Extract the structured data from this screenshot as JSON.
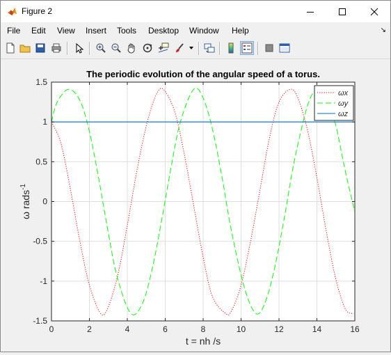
{
  "window": {
    "title": "Figure 2"
  },
  "menu": {
    "items": [
      "File",
      "Edit",
      "View",
      "Insert",
      "Tools",
      "Desktop",
      "Window",
      "Help"
    ]
  },
  "toolbar": {
    "buttons": [
      {
        "name": "new-figure-icon"
      },
      {
        "name": "open-file-icon"
      },
      {
        "name": "save-icon"
      },
      {
        "name": "print-icon"
      },
      {
        "name": "edit-plot-arrow-icon"
      },
      {
        "name": "zoom-in-icon"
      },
      {
        "name": "zoom-out-icon"
      },
      {
        "name": "pan-hand-icon"
      },
      {
        "name": "rotate-3d-icon"
      },
      {
        "name": "data-cursor-icon"
      },
      {
        "name": "brush-icon"
      },
      {
        "name": "link-plot-icon"
      },
      {
        "name": "colorbar-icon"
      },
      {
        "name": "legend-icon"
      },
      {
        "name": "hide-plot-tools-icon"
      },
      {
        "name": "show-plot-tools-icon"
      }
    ]
  },
  "chart_data": {
    "type": "line",
    "title": "The periodic evolution of the angular speed of a torus.",
    "xlabel": "t = nh /s",
    "ylabel": "ω rads",
    "ylabel_exponent": "-1",
    "xlim": [
      0,
      16
    ],
    "ylim": [
      -1.5,
      1.5
    ],
    "xticks": [
      "0",
      "2",
      "4",
      "6",
      "8",
      "10",
      "12",
      "14",
      "16"
    ],
    "yticks": [
      "1.5",
      "1",
      "0.5",
      "0",
      "-0.5",
      "-1",
      "-1.5"
    ],
    "grid": true,
    "legend_position": "top-right",
    "series": [
      {
        "name": "ωx",
        "style": "dotted",
        "color": "#ff0000",
        "x": [
          0,
          0.5,
          1,
          1.5,
          2,
          2.6,
          3,
          3.5,
          4,
          4.5,
          5,
          5.5,
          5.9,
          6.5,
          7,
          7.5,
          8,
          8.5,
          9.2,
          9.5,
          10,
          10.5,
          11,
          11.5,
          12,
          12.6,
          13,
          13.5,
          14,
          14.5,
          15,
          15.5,
          15.9
        ],
        "y": [
          1,
          0.73,
          0.15,
          -0.5,
          -1.05,
          -1.41,
          -1.32,
          -0.92,
          -0.3,
          0.38,
          0.95,
          1.33,
          1.41,
          1.13,
          0.6,
          -0.05,
          -0.7,
          -1.2,
          -1.41,
          -1.37,
          -1.05,
          -0.5,
          0.15,
          0.8,
          1.25,
          1.41,
          1.3,
          0.9,
          0.3,
          -0.38,
          -0.98,
          -1.35,
          -1.41
        ]
      },
      {
        "name": "ωy",
        "style": "dashed",
        "color": "#00ff00",
        "x": [
          0,
          0.3,
          0.9,
          1.5,
          2,
          2.5,
          3,
          3.5,
          4.2,
          4.8,
          5.3,
          5.8,
          6.3,
          6.8,
          7.5,
          8,
          8.5,
          9,
          9.5,
          10.2,
          10.8,
          11.3,
          11.8,
          12.3,
          12.8,
          13.5,
          14,
          14.5,
          15,
          15.5,
          16
        ],
        "y": [
          1,
          1.25,
          1.41,
          1.27,
          0.88,
          0.28,
          -0.4,
          -0.98,
          -1.41,
          -1.28,
          -0.86,
          -0.25,
          0.42,
          1.0,
          1.41,
          1.3,
          0.9,
          0.3,
          -0.38,
          -1.1,
          -1.41,
          -1.25,
          -0.8,
          -0.18,
          0.5,
          1.2,
          1.41,
          1.3,
          0.95,
          0.38,
          -0.13
        ]
      },
      {
        "name": "ωz",
        "style": "solid",
        "color": "#0072bd",
        "x": [
          0,
          16
        ],
        "y": [
          1,
          1
        ]
      }
    ]
  }
}
